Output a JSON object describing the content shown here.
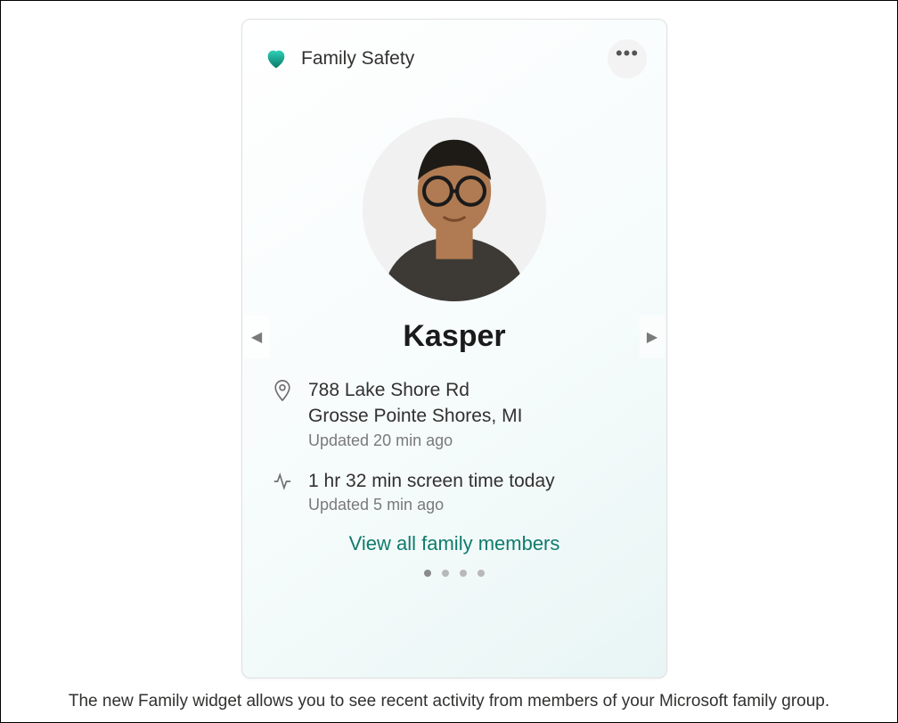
{
  "widget": {
    "title": "Family Safety",
    "icon": "heart-shield-icon",
    "more_icon": "more-horizontal-icon"
  },
  "member": {
    "name": "Kasper",
    "avatar_alt": "Profile photo of Kasper"
  },
  "location": {
    "icon": "location-pin-icon",
    "line1": "788 Lake Shore Rd",
    "line2": "Grosse Pointe Shores, MI",
    "updated": "Updated 20 min ago"
  },
  "screen_time": {
    "icon": "activity-pulse-icon",
    "line1": "1 hr 32 min screen time today",
    "updated": "Updated 5 min ago"
  },
  "nav": {
    "prev_icon": "chevron-left-icon",
    "next_icon": "chevron-right-icon"
  },
  "actions": {
    "view_all": "View all family members"
  },
  "pager": {
    "count": 4,
    "active_index": 0
  },
  "caption": "The new Family widget allows you to see recent activity from members of your Microsoft family group.",
  "colors": {
    "accent": "#0f7b6c",
    "heart_gradient_start": "#1fbba6",
    "heart_gradient_end": "#0a7866"
  }
}
